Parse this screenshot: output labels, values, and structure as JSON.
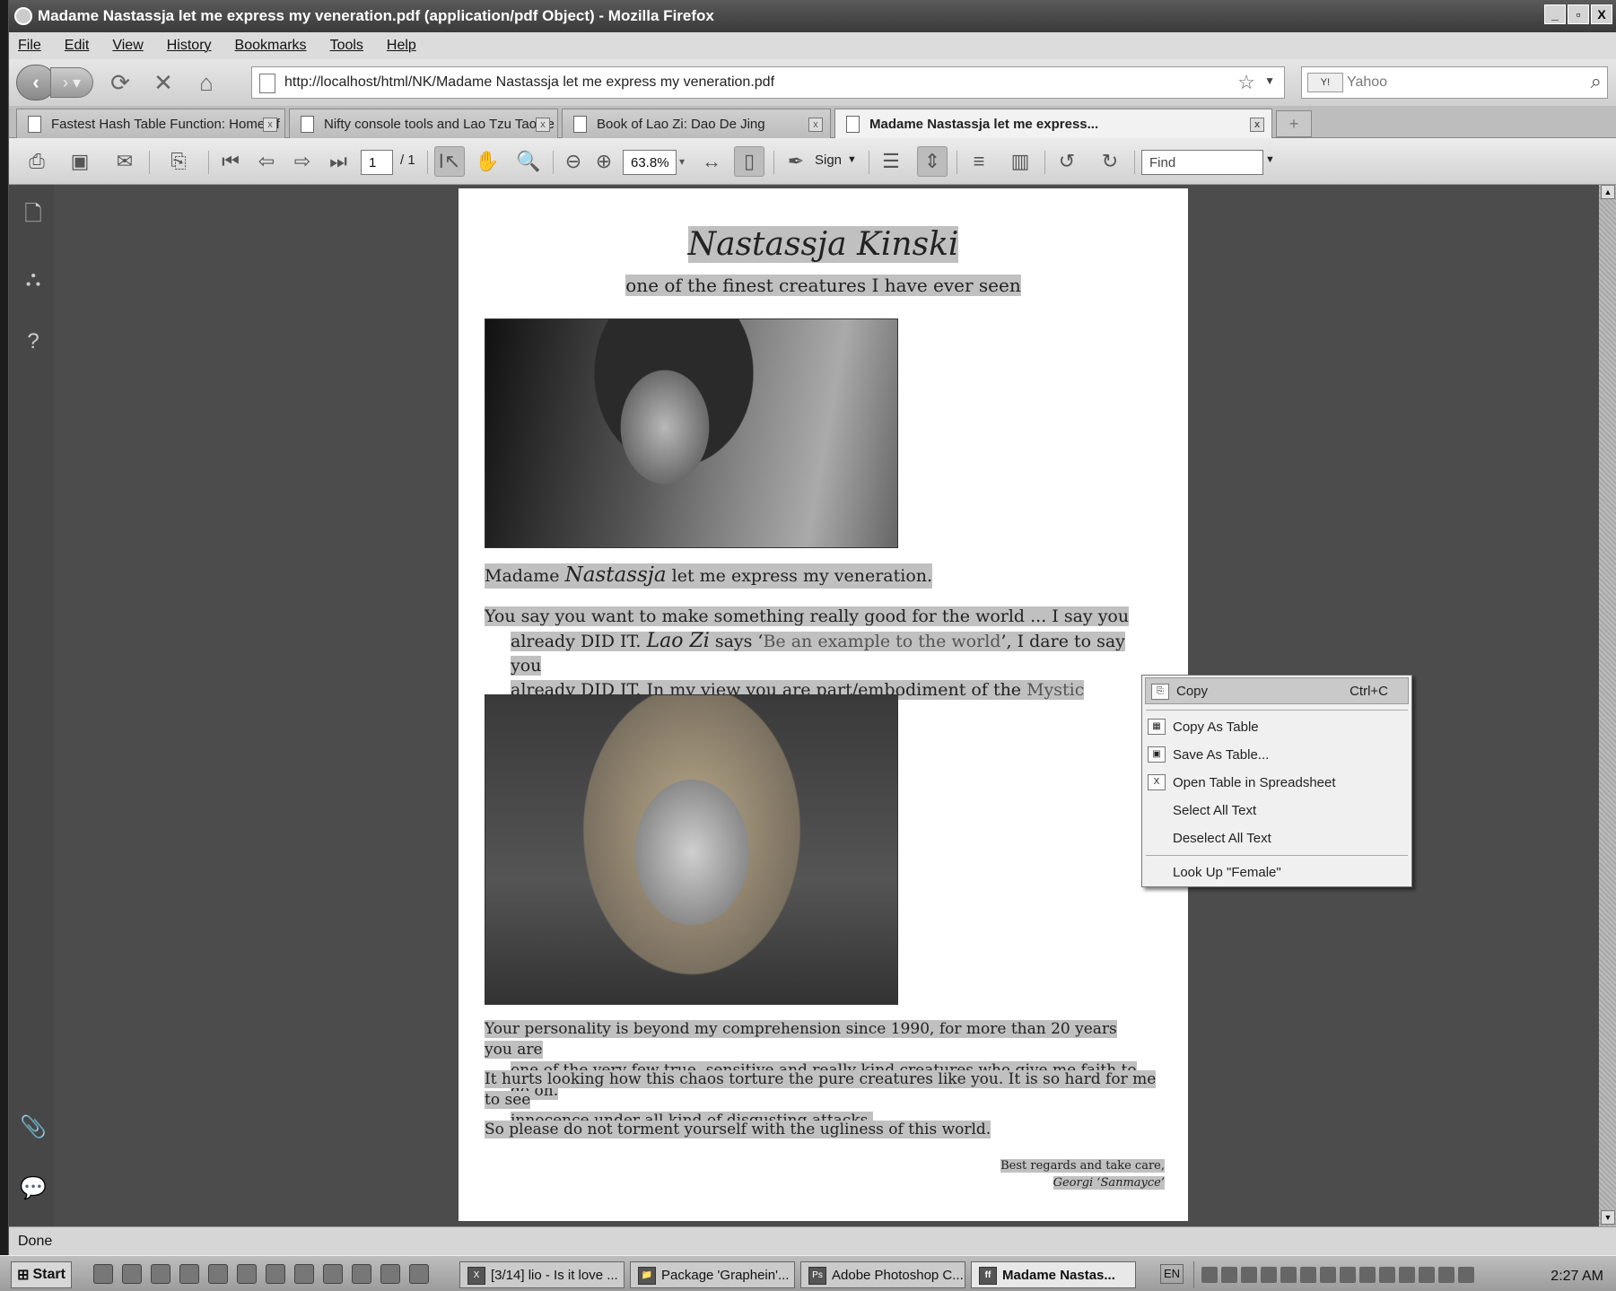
{
  "window": {
    "title": "Madame Nastassja let me express my veneration.pdf (application/pdf Object) - Mozilla Firefox",
    "controls": [
      "_",
      "▫",
      "X"
    ]
  },
  "menu": [
    "File",
    "Edit",
    "View",
    "History",
    "Bookmarks",
    "Tools",
    "Help"
  ],
  "nav": {
    "url": "http://localhost/html/NK/Madame Nastassja let me express my veneration.pdf",
    "search_engine": "Y!",
    "search_placeholder": "Yahoo"
  },
  "tabs": [
    {
      "label": "Fastest Hash Table Function: Home of F...",
      "active": false
    },
    {
      "label": "Nifty console tools and Lao Tzu Tao Te ...",
      "active": false
    },
    {
      "label": "Book of Lao Zi: Dao De Jing",
      "active": false
    },
    {
      "label": "Madame Nastassja let me express...",
      "active": true
    }
  ],
  "pdf_toolbar": {
    "page_current": "1",
    "page_total": "/ 1",
    "zoom": "63.8%",
    "sign_label": "Sign",
    "find_placeholder": "Find"
  },
  "document": {
    "title": "Nastassja Kinski",
    "subtitle": "one of the finest creatures I have ever seen",
    "p1_pre": "Madame ",
    "p1_it": "Nastassja",
    "p1_post": " let me express my veneration.",
    "p2_a": "You say you want to make something really good for the world ... I say you",
    "p2_b1": "already DID IT. ",
    "p2_b_it": "Lao Zi",
    "p2_b2": " says ‘",
    "p2_b_quote": "Be an example to the world",
    "p2_b3": "’, I dare to say you",
    "p2_c1": "already DID IT. In my view you are part/embodiment of the ",
    "p2_c_gray": "Mystic Female",
    "p2_c2": ".",
    "p3_a": "Your personality is beyond my comprehension since 1990, for more than 20 years you are",
    "p3_b": "one of the very few true, sensitive and really kind creatures who give me faith to go on.",
    "p4_a": "It hurts looking how this chaos torture the pure creatures like you. It is so hard for me to see",
    "p4_b": "innocence under all kind of disgusting attacks.",
    "p5": "So please do not torment yourself with the ugliness of this world.",
    "sig_line1": "Best regards and take care,",
    "sig_line2": "Georgi ‘Sanmayce’"
  },
  "context_menu": {
    "copy": "Copy",
    "copy_shortcut": "Ctrl+C",
    "copy_as_table": "Copy As Table",
    "save_as_table": "Save As Table...",
    "open_table": "Open Table in Spreadsheet",
    "select_all": "Select All Text",
    "deselect_all": "Deselect All Text",
    "look_up": "Look Up \"Female\""
  },
  "status": "Done",
  "taskbar": {
    "start": "Start",
    "tasks": [
      {
        "label": "[3/14] lio - Is it love ...",
        "icon": "X"
      },
      {
        "label": "Package 'Graphein'...",
        "icon": "📁"
      },
      {
        "label": "Adobe Photoshop C...",
        "icon": "Ps"
      },
      {
        "label": "Madame Nastas...",
        "icon": "ff"
      }
    ],
    "lang": "EN",
    "clock": "2:27 AM"
  }
}
